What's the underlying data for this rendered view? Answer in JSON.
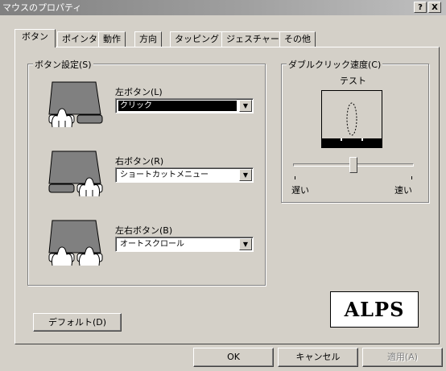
{
  "window": {
    "title": "マウスのプロパティ",
    "help_button": "?",
    "close_button": "X"
  },
  "tabs": [
    {
      "label": "ボタン",
      "active": true
    },
    {
      "label": "ポインタ"
    },
    {
      "label": "動作"
    },
    {
      "label": "方向"
    },
    {
      "label": "タッピング"
    },
    {
      "label": "ジェスチャー"
    },
    {
      "label": "その他"
    }
  ],
  "button_settings": {
    "legend": "ボタン設定(S)",
    "left": {
      "label": "左ボタン(L)",
      "value": "クリック"
    },
    "right": {
      "label": "右ボタン(R)",
      "value": "ショートカットメニュー"
    },
    "both": {
      "label": "左右ボタン(B)",
      "value": "オートスクロール"
    }
  },
  "double_click": {
    "legend": "ダブルクリック速度(C)",
    "test_label": "テスト",
    "slow_label": "遅い",
    "fast_label": "速い",
    "speed_fraction": 0.5
  },
  "default_button": "デフォルト(D)",
  "logo_text": "ALPS",
  "footer": {
    "ok": "OK",
    "cancel": "キャンセル",
    "apply": "適用(A)"
  },
  "colors": {
    "titlebar": "#808080",
    "face": "#d4d0c8"
  }
}
